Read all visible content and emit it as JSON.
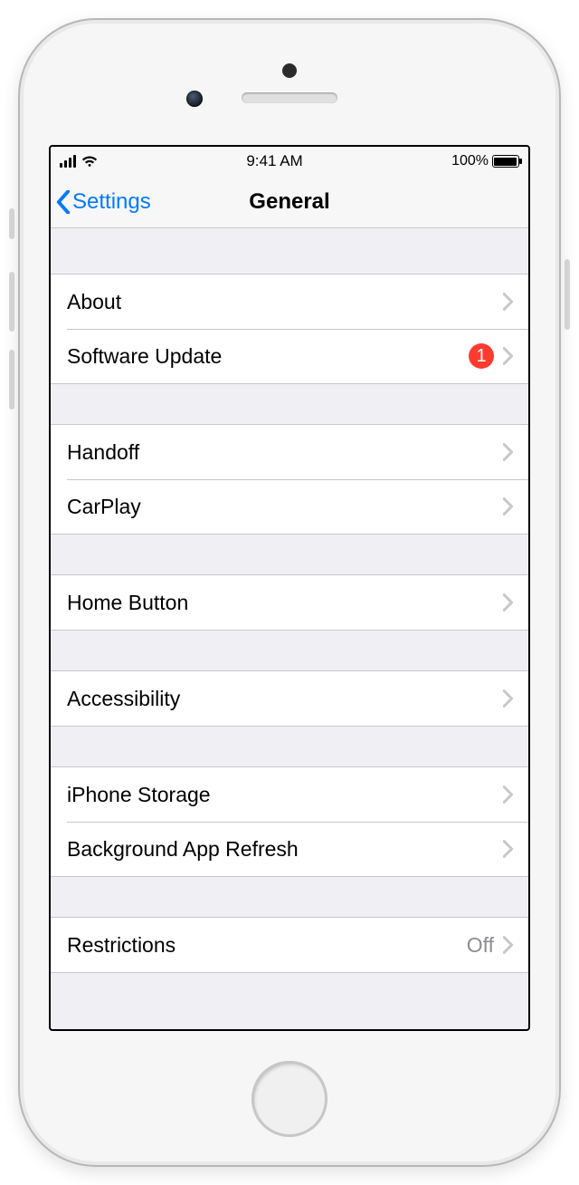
{
  "statusbar": {
    "time": "9:41 AM",
    "battery_pct": "100%"
  },
  "navbar": {
    "back_label": "Settings",
    "title": "General"
  },
  "sections": [
    {
      "rows": [
        {
          "label": "About",
          "badge": null,
          "value": null
        },
        {
          "label": "Software Update",
          "badge": "1",
          "value": null
        }
      ]
    },
    {
      "rows": [
        {
          "label": "Handoff",
          "badge": null,
          "value": null
        },
        {
          "label": "CarPlay",
          "badge": null,
          "value": null
        }
      ]
    },
    {
      "rows": [
        {
          "label": "Home Button",
          "badge": null,
          "value": null
        }
      ]
    },
    {
      "rows": [
        {
          "label": "Accessibility",
          "badge": null,
          "value": null
        }
      ]
    },
    {
      "rows": [
        {
          "label": "iPhone Storage",
          "badge": null,
          "value": null
        },
        {
          "label": "Background App Refresh",
          "badge": null,
          "value": null
        }
      ]
    },
    {
      "rows": [
        {
          "label": "Restrictions",
          "badge": null,
          "value": "Off"
        }
      ]
    }
  ],
  "colors": {
    "tint": "#007aff",
    "badge": "#ff3b30",
    "separator": "#c7c7cb",
    "bg": "#efeff4"
  }
}
